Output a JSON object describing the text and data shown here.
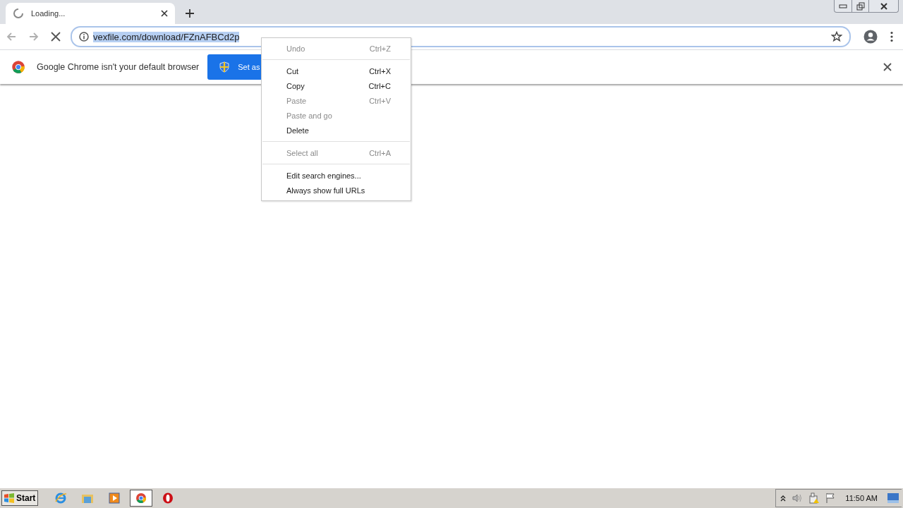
{
  "tab": {
    "title": "Loading...",
    "loading": true
  },
  "toolbar": {
    "back_disabled": true,
    "forward_disabled": true,
    "url": "vexfile.com/download/FZnAFBCd2p",
    "url_selected": true
  },
  "infobar": {
    "message": "Google Chrome isn't your default browser",
    "button": "Set as"
  },
  "context_menu": [
    {
      "kind": "item",
      "label": "Undo",
      "shortcut": "Ctrl+Z",
      "disabled": true
    },
    {
      "kind": "separator"
    },
    {
      "kind": "item",
      "label": "Cut",
      "shortcut": "Ctrl+X",
      "disabled": false
    },
    {
      "kind": "item",
      "label": "Copy",
      "shortcut": "Ctrl+C",
      "disabled": false
    },
    {
      "kind": "item",
      "label": "Paste",
      "shortcut": "Ctrl+V",
      "disabled": true
    },
    {
      "kind": "item",
      "label": "Paste and go",
      "disabled": true
    },
    {
      "kind": "item",
      "label": "Delete",
      "disabled": false
    },
    {
      "kind": "separator"
    },
    {
      "kind": "item",
      "label": "Select all",
      "shortcut": "Ctrl+A",
      "disabled": true
    },
    {
      "kind": "separator"
    },
    {
      "kind": "item",
      "label": "Edit search engines...",
      "disabled": false
    },
    {
      "kind": "item",
      "label": "Always show full URLs",
      "disabled": false
    }
  ],
  "taskbar": {
    "start": "Start",
    "apps": [
      {
        "kind": "ie",
        "selected": false
      },
      {
        "kind": "explorer",
        "selected": false
      },
      {
        "kind": "media",
        "selected": false
      },
      {
        "kind": "chrome",
        "selected": true
      },
      {
        "kind": "opera",
        "selected": false
      }
    ],
    "clock": "11:50 AM"
  }
}
